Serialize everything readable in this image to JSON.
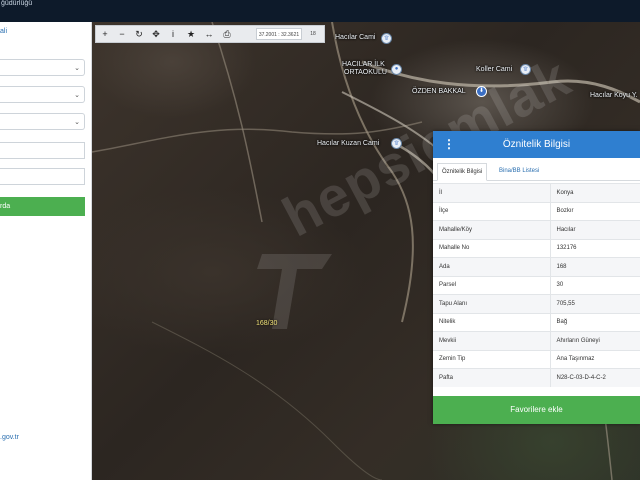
{
  "topbar": {
    "title": "ğüdürlüğü"
  },
  "sidebar": {
    "header_link": "ali",
    "search_button": "rda",
    "footer_link": ".gov.tr",
    "selects": [
      {
        "value": ""
      },
      {
        "value": ""
      },
      {
        "value": ""
      }
    ]
  },
  "toolbar": {
    "coord": "37.2001 : 32.3621",
    "zoom": "18",
    "buttons": [
      {
        "icon": "zoom-in-icon",
        "glyph": "+"
      },
      {
        "icon": "zoom-out-icon",
        "glyph": "−"
      },
      {
        "icon": "refresh-icon",
        "glyph": "↻"
      },
      {
        "icon": "locate-icon",
        "glyph": "✥"
      },
      {
        "icon": "info-icon",
        "glyph": "i"
      },
      {
        "icon": "star-icon",
        "glyph": "★"
      },
      {
        "icon": "measure-icon",
        "glyph": "↔"
      },
      {
        "icon": "print-icon",
        "glyph": "⎙"
      }
    ]
  },
  "map": {
    "labels": {
      "cami1": "Hacılar Cami",
      "okul1": "HACILAR İLK",
      "okul2": "ORTAOKULU",
      "cami2": "Koller Cami",
      "bakkal": "ÖZDEN BAKKAL",
      "road": "Hacılar Koyu Y.",
      "cami3": "Hacılar Kuzan Cami"
    },
    "parcel": "168/30",
    "watermark": "hepsiemlak"
  },
  "panel": {
    "title": "Öznitelik Bilgisi",
    "tabs": [
      "Öznitelik Bilgisi",
      "Bina/BB Listesi"
    ],
    "rows": [
      {
        "label": "İl",
        "value": "Konya"
      },
      {
        "label": "İlçe",
        "value": "Bozkır"
      },
      {
        "label": "Mahalle/Köy",
        "value": "Hacılar"
      },
      {
        "label": "Mahalle No",
        "value": "132176"
      },
      {
        "label": "Ada",
        "value": "168"
      },
      {
        "label": "Parsel",
        "value": "30"
      },
      {
        "label": "Tapu Alanı",
        "value": "705,55"
      },
      {
        "label": "Nitelik",
        "value": "Bağ"
      },
      {
        "label": "Mevkii",
        "value": "Ahırların Güneyi"
      },
      {
        "label": "Zemin Tip",
        "value": "Ana Taşınmaz"
      },
      {
        "label": "Pafta",
        "value": "N28-C-03-D-4-C-2"
      }
    ],
    "favorite_button": "Favorilere ekle"
  },
  "colors": {
    "accent": "#2f7fd0",
    "button_green": "#4caf50",
    "topbar": "#0d1a2a"
  }
}
